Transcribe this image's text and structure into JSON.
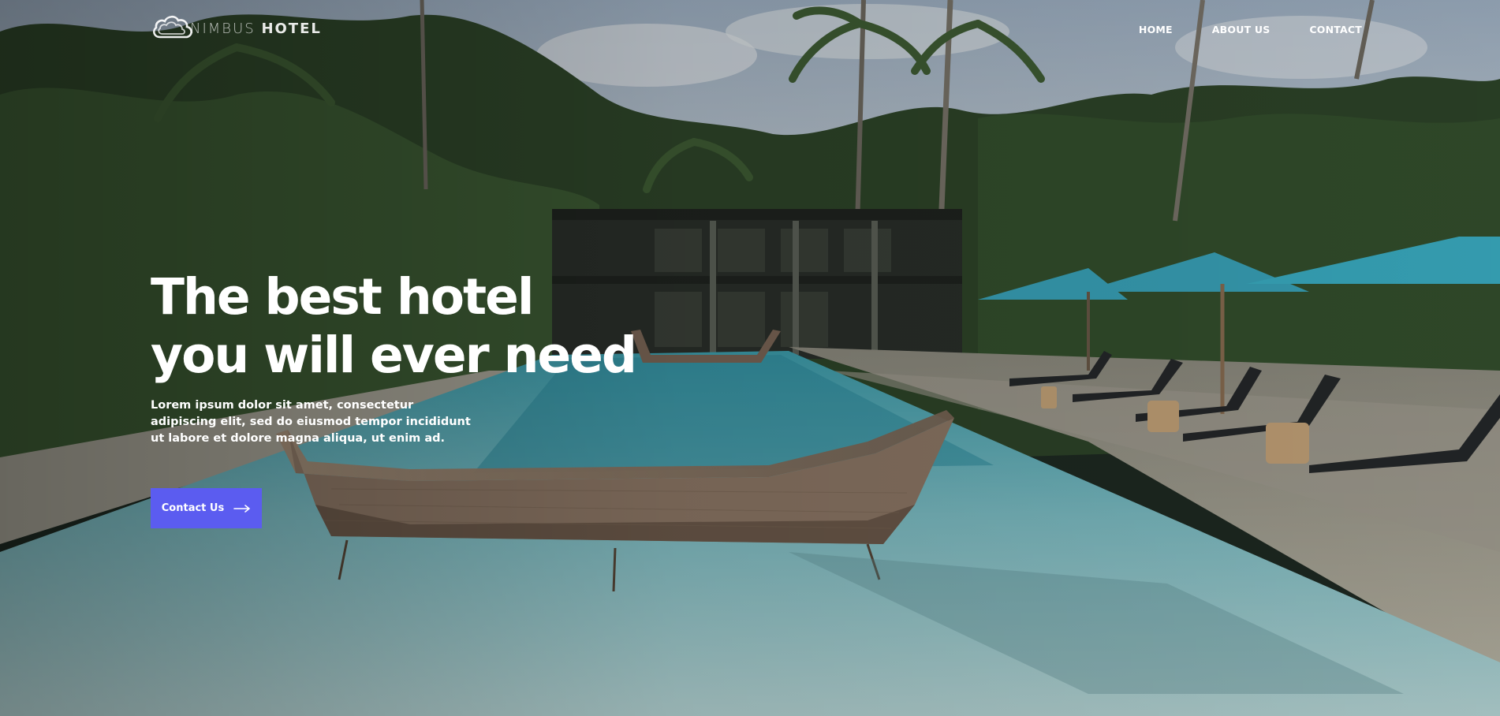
{
  "brand": {
    "name_part1": "NIMBUS",
    "name_part2": "HOTEL",
    "logo_icon": "cloud-icon"
  },
  "nav": {
    "items": [
      {
        "label": "HOME"
      },
      {
        "label": "ABOUT US"
      },
      {
        "label": "CONTACT"
      }
    ]
  },
  "hero": {
    "headline_line1": "The best hotel",
    "headline_line2": "you will ever need",
    "subtext": "Lorem ipsum dolor sit amet, consectetur adipiscing elit, sed do eiusmod tempor incididunt ut labore et dolore magna aliqua, ut enim ad.",
    "cta_label": "Contact Us",
    "cta_icon": "arrow-right-icon",
    "background": "resort-pool-photo"
  },
  "colors": {
    "accent": "#5b5cf0",
    "text": "#ffffff",
    "pool": "#6fb9c2",
    "umbrella": "#3aa6bd",
    "foliage": "#2f4a2c"
  }
}
